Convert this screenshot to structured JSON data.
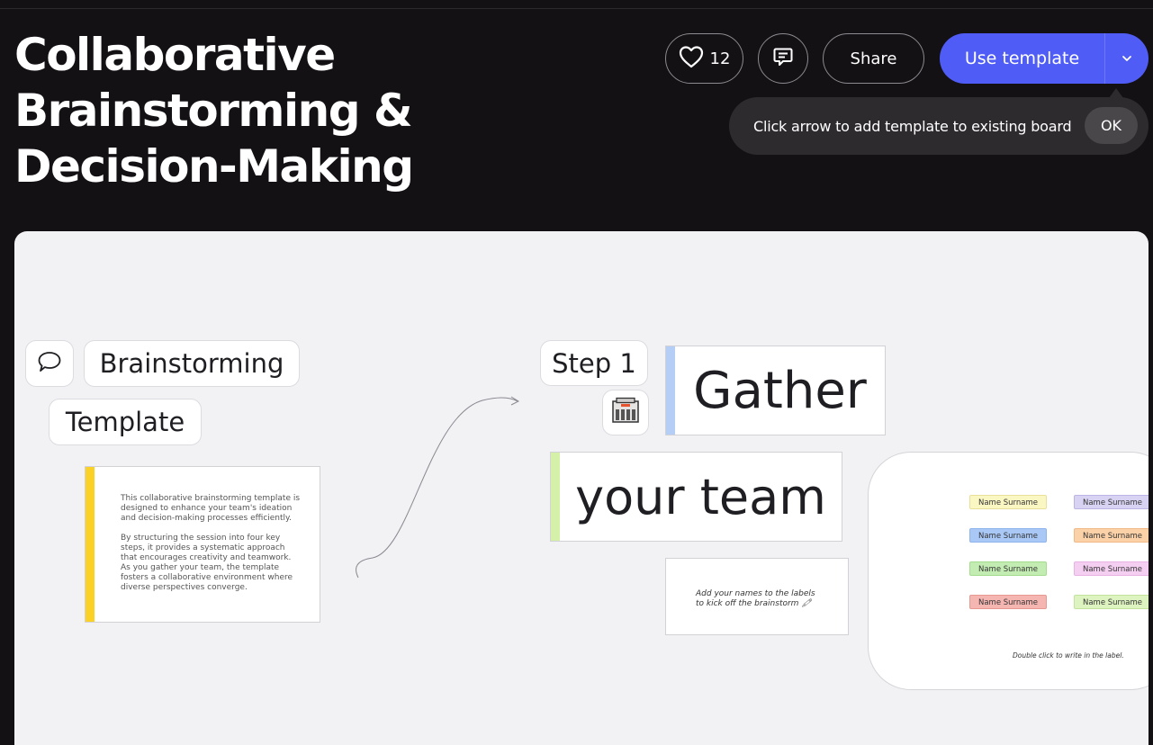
{
  "header": {
    "title": "Collaborative Brainstorming & Decision-Making",
    "like_count": "12",
    "share_label": "Share",
    "use_template_label": "Use template"
  },
  "tooltip": {
    "message": "Click arrow to add template to existing board",
    "ok_label": "OK"
  },
  "canvas": {
    "brainstorming_label": "Brainstorming",
    "template_label": "Template",
    "step_label": "Step 1",
    "gather_label": "Gather",
    "your_team_label": "your team",
    "description_p1": "This collaborative brainstorming template is designed to enhance your team's ideation and decision-making processes efficiently.",
    "description_p2": "By structuring the session into four key steps, it provides a systematic approach that encourages creativity and teamwork. As you gather your team, the template fosters a collaborative environment where diverse perspectives converge.",
    "instruction_note": "Add your names to the labels to kick off the brainstorm 🖍",
    "name_labels": [
      {
        "text": "Name Surname",
        "color": "#fbf7c3"
      },
      {
        "text": "Name Surname",
        "color": "#d9d3f3"
      },
      {
        "text": "Name Surname",
        "color": "#a9c8f6"
      },
      {
        "text": "Name Surname",
        "color": "#fbd1a8"
      },
      {
        "text": "Name Surname",
        "color": "#c3ecb2"
      },
      {
        "text": "Name Surname",
        "color": "#f5cff2"
      },
      {
        "text": "Name Surname",
        "color": "#f5b5b1"
      },
      {
        "text": "Name Surname",
        "color": "#def4c0"
      }
    ],
    "double_click_hint": "Double click to write in the label."
  },
  "colors": {
    "accent": "#4f5df6",
    "background": "#141114",
    "canvas": "#f2f1f4"
  }
}
